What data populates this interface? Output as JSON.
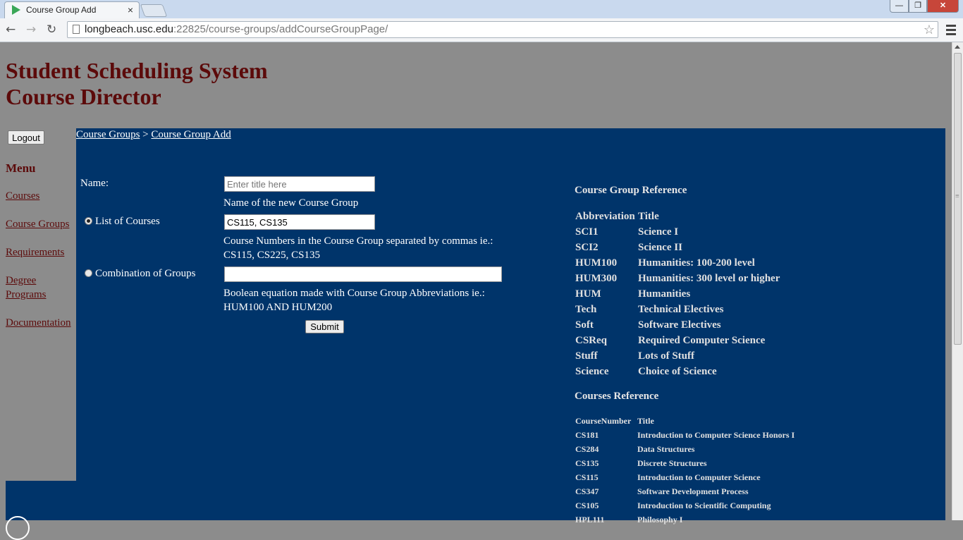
{
  "browser": {
    "tab_title": "Course Group Add",
    "tab_close": "×",
    "url_host": "longbeach.usc.edu",
    "url_path": ":22825/course-groups/addCourseGroupPage/",
    "back": "←",
    "forward": "→",
    "reload": "↻",
    "star": "☆",
    "win_min": "—",
    "win_max": "❐",
    "win_close": "✕"
  },
  "header": {
    "line1": "Student Scheduling System",
    "line2": "Course Director"
  },
  "sidebar": {
    "logout": "Logout",
    "menu_heading": "Menu",
    "items": [
      "Courses",
      "Course Groups",
      "Requirements",
      "Degree Programs",
      "Documentation"
    ]
  },
  "breadcrumb": {
    "item1": "Course Groups",
    "separator": " > ",
    "item2": "Course Group Add"
  },
  "form": {
    "name_label": "Name:",
    "name_placeholder": "Enter title here",
    "name_help": "Name of the new Course Group",
    "list_label": "List of Courses",
    "list_value": "CS115, CS135",
    "list_help": "Course Numbers in the Course Group separated by commas ie.: CS115, CS225, CS135",
    "combo_label": "Combination of Groups",
    "combo_value": "",
    "combo_help": "Boolean equation made with Course Group Abbreviations ie.: HUM100 AND HUM200",
    "selected_option": "List of Courses",
    "submit": "Submit"
  },
  "group_reference": {
    "title": "Course Group Reference",
    "headers": [
      "Abbreviation",
      "Title"
    ],
    "rows": [
      [
        "SCI1",
        "Science I"
      ],
      [
        "SCI2",
        "Science II"
      ],
      [
        "HUM100",
        "Humanities: 100-200 level"
      ],
      [
        "HUM300",
        "Humanities: 300 level or higher"
      ],
      [
        "HUM",
        "Humanities"
      ],
      [
        "Tech",
        "Technical Electives"
      ],
      [
        "Soft",
        "Software Electives"
      ],
      [
        "CSReq",
        "Required Computer Science"
      ],
      [
        "Stuff",
        "Lots of Stuff"
      ],
      [
        "Science",
        "Choice of Science"
      ]
    ]
  },
  "courses_reference": {
    "title": "Courses Reference",
    "headers": [
      "CourseNumber",
      "Title"
    ],
    "rows": [
      [
        "CS181",
        "Introduction to Computer Science Honors I"
      ],
      [
        "CS284",
        "Data Structures"
      ],
      [
        "CS135",
        "Discrete Structures"
      ],
      [
        "CS115",
        "Introduction to Computer Science"
      ],
      [
        "CS347",
        "Software Development Process"
      ],
      [
        "CS105",
        "Introduction to Scientific Computing"
      ],
      [
        "HPL111",
        "Philosophy I"
      ]
    ]
  },
  "colors": {
    "page_bg": "#8c8c8c",
    "content_bg": "#00346a",
    "title_color": "#5c0a0a"
  }
}
